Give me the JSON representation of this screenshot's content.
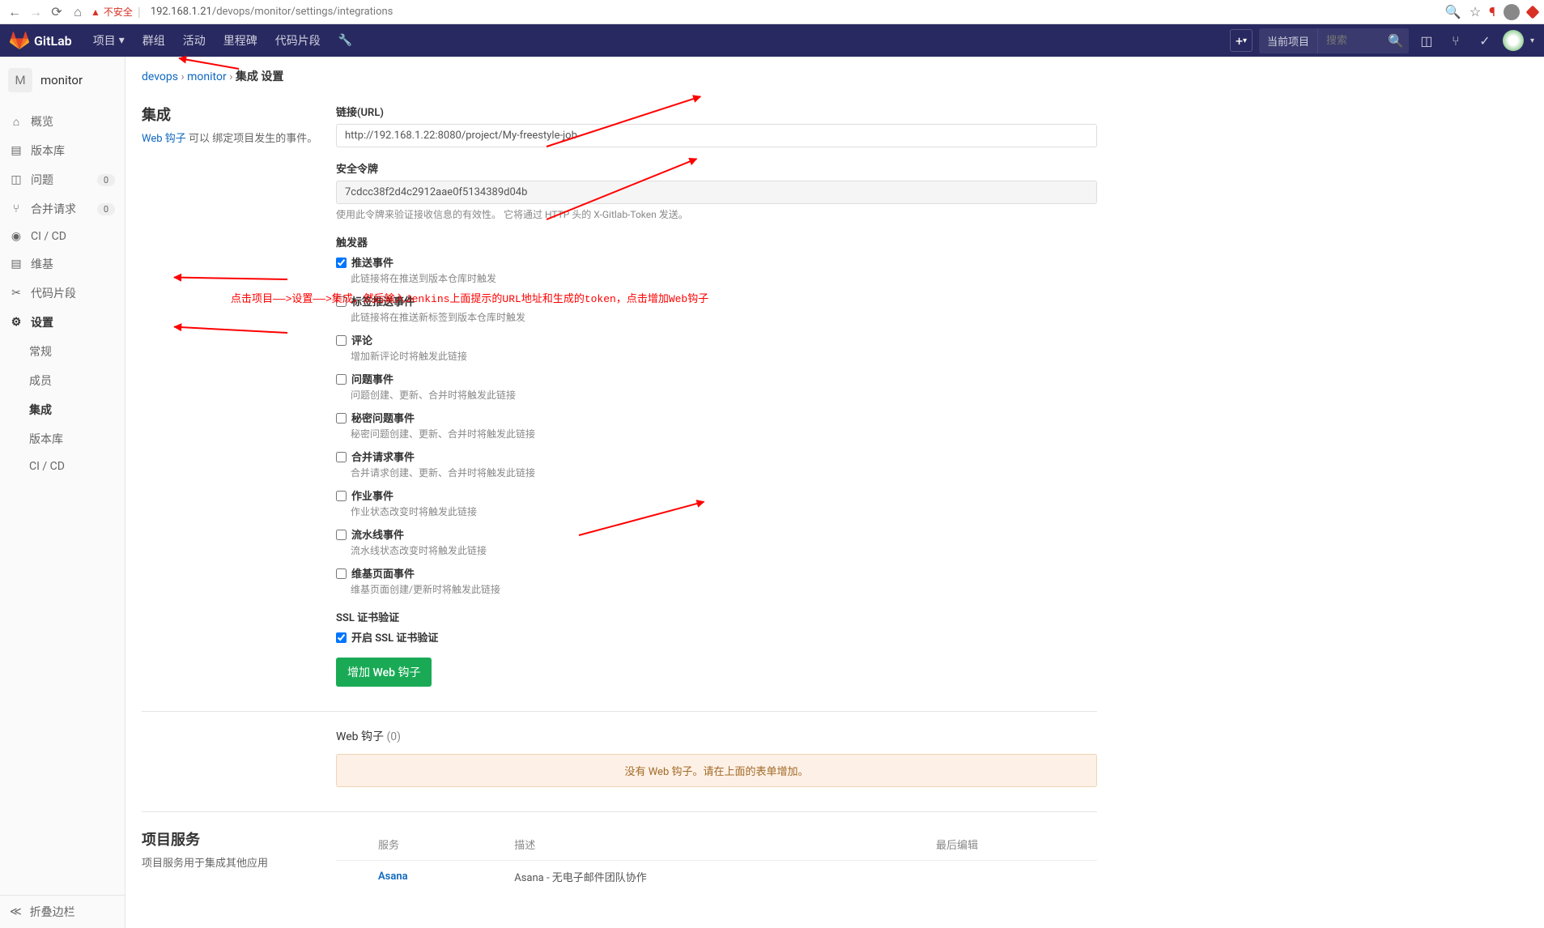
{
  "browser": {
    "insecure": "不安全",
    "url_host": "192.168.1.21",
    "url_path": "/devops/monitor/settings/integrations"
  },
  "navbar": {
    "logo": "GitLab",
    "items": [
      "项目",
      "群组",
      "活动",
      "里程碑",
      "代码片段"
    ],
    "search_project": "当前项目",
    "search_placeholder": "搜索"
  },
  "sidebar": {
    "project_letter": "M",
    "project_name": "monitor",
    "items": [
      {
        "icon": "home",
        "label": "概览"
      },
      {
        "icon": "repo",
        "label": "版本库"
      },
      {
        "icon": "issues",
        "label": "问题",
        "badge": "0"
      },
      {
        "icon": "merge",
        "label": "合并请求",
        "badge": "0"
      },
      {
        "icon": "cicd",
        "label": "CI / CD"
      },
      {
        "icon": "wiki",
        "label": "维基"
      },
      {
        "icon": "snippets",
        "label": "代码片段"
      },
      {
        "icon": "settings",
        "label": "设置",
        "active": true
      }
    ],
    "subitems": [
      {
        "label": "常规"
      },
      {
        "label": "成员"
      },
      {
        "label": "集成",
        "active": true
      },
      {
        "label": "版本库"
      },
      {
        "label": "CI / CD"
      }
    ],
    "collapse": "折叠边栏"
  },
  "breadcrumb": {
    "project": "devops",
    "subproject": "monitor",
    "page": "集成 设置"
  },
  "integrations": {
    "title": "集成",
    "desc_link": "Web 钩子",
    "desc_text": " 可以 绑定项目发生的事件。",
    "url_label": "链接(URL)",
    "url_value": "http://192.168.1.22:8080/project/My-freestyle-job",
    "token_label": "安全令牌",
    "token_value": "7cdcc38f2d4c2912aae0f5134389d04b",
    "token_help": "使用此令牌来验证接收信息的有效性。 它将通过 HTTP 头的 X-Gitlab-Token 发送。",
    "triggers_label": "触发器",
    "triggers": [
      {
        "label": "推送事件",
        "desc": "此链接将在推送到版本仓库时触发",
        "checked": true
      },
      {
        "label": "标签推送事件",
        "desc": "此链接将在推送新标签到版本仓库时触发",
        "checked": false
      },
      {
        "label": "评论",
        "desc": "增加新评论时将触发此链接",
        "checked": false
      },
      {
        "label": "问题事件",
        "desc": "问题创建、更新、合并时将触发此链接",
        "checked": false
      },
      {
        "label": "秘密问题事件",
        "desc": "秘密问题创建、更新、合并时将触发此链接",
        "checked": false
      },
      {
        "label": "合并请求事件",
        "desc": "合并请求创建、更新、合并时将触发此链接",
        "checked": false
      },
      {
        "label": "作业事件",
        "desc": "作业状态改变时将触发此链接",
        "checked": false
      },
      {
        "label": "流水线事件",
        "desc": "流水线状态改变时将触发此链接",
        "checked": false
      },
      {
        "label": "维基页面事件",
        "desc": "维基页面创建/更新时将触发此链接",
        "checked": false
      }
    ],
    "ssl_label": "SSL 证书验证",
    "ssl_check": "开启 SSL 证书验证",
    "submit_btn": "增加 Web 钩子",
    "webhooks_label": "Web 钩子",
    "webhooks_count": "(0)",
    "empty_notice": "没有 Web 钩子。请在上面的表单增加。"
  },
  "services": {
    "title": "项目服务",
    "desc": "项目服务用于集成其他应用",
    "cols": [
      "服务",
      "描述",
      "最后编辑"
    ],
    "rows": [
      {
        "name": "Asana",
        "desc": "Asana - 无电子邮件团队协作"
      }
    ]
  },
  "annotation": "点击项目——>设置——>集成，然后输入Jenkins上面提示的URL地址和生成的token，点击增加Web钩子"
}
